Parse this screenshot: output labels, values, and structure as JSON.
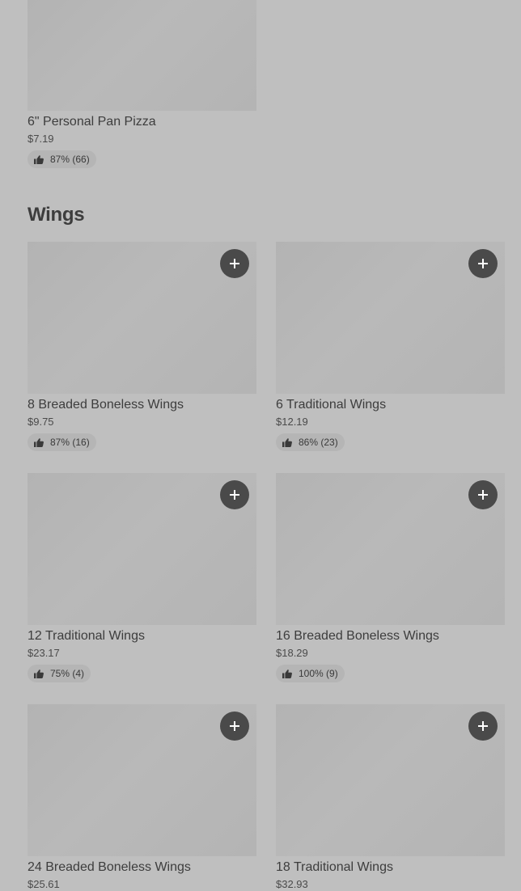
{
  "top_item": {
    "name": "6\" Personal Pan Pizza",
    "price": "$7.19",
    "rating": "87% (66)"
  },
  "section": {
    "title": "Wings"
  },
  "items": [
    {
      "name": "8 Breaded Boneless Wings",
      "price": "$9.75",
      "rating": "87% (16)"
    },
    {
      "name": "6 Traditional Wings",
      "price": "$12.19",
      "rating": "86% (23)"
    },
    {
      "name": "12 Traditional Wings",
      "price": "$23.17",
      "rating": "75% (4)"
    },
    {
      "name": "16 Breaded Boneless Wings",
      "price": "$18.29",
      "rating": "100% (9)"
    },
    {
      "name": "24 Breaded Boneless Wings",
      "price": "$25.61"
    },
    {
      "name": "18 Traditional Wings",
      "price": "$32.93"
    }
  ],
  "icons": {
    "add": "plus-icon",
    "rating": "thumbs-up-icon"
  },
  "colors": {
    "background": "#bfbfbf",
    "image_placeholder": "#b6b6b6",
    "add_button": "#4a4a4a",
    "rating_pill": "#b5b5b5",
    "text": "#3d3d3d"
  }
}
